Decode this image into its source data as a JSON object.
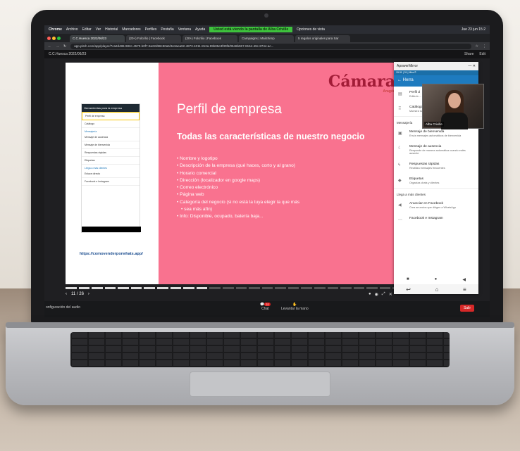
{
  "mac_menubar": {
    "items": [
      "Chrome",
      "Archivo",
      "Editar",
      "Ver",
      "Historial",
      "Marcadores",
      "Perfiles",
      "Pestaña",
      "Ventana",
      "Ayuda"
    ],
    "sub": "Grabando",
    "sharing_banner": "Usted está viendo la pantalla de Alba Criville",
    "view_options": "Opciones de vista",
    "clock": "Jue 23 jun 15:2"
  },
  "browser": {
    "tabs": [
      "C.C.Huesca 2022/06/23",
      "(20+) Folcrilio | Facebook",
      "(20+) Folcrilio | Facebook",
      "Campaigns | Mailchimp",
      "5 regalos originales para Sar"
    ],
    "url": "app.pitch.com/app/player/7ca2d486-982c-4570-b0f7-8a22d98c90a5/3e3aea92-4873-4011-812a-99b85e3f30f6/0546b067-8154-49c-8744-ac..."
  },
  "pitch": {
    "doc_title": "C.C.Huesca 2022/06/23",
    "share_label": "Share",
    "edit_label": "Edit",
    "page_indicator": "11 / 26"
  },
  "slide": {
    "logo": "Cámara",
    "logo_sub": "Aragón",
    "title": "Perfil de empresa",
    "subtitle": "Todas las características de nuestro negocio",
    "bullets": [
      "Nombre y logotipo",
      "Descripción de la empresa (qué haces, corto y al grano)",
      "Horario comercial",
      "Dirección (localizador en google maps)",
      "Correo electrónico",
      "Página web",
      "Categoría del negocio (si no está la tuya elegir la que más",
      "sea más afín)",
      "Info: Disponible, ocupado, batería baja..."
    ],
    "link": "https://comovenderporwhats.app/",
    "phone_header": "Herramientas para la empresa",
    "phone_items": [
      "Perfil de empresa",
      "Catálogo",
      "Mensaje de ausencia",
      "Mensaje de bienvenida",
      "Respuestas rápidas",
      "Etiquetas"
    ],
    "phone_section1": "Mensajería",
    "phone_section2": "Llega a más clientes",
    "phone_items2": [
      "Enlace directo",
      "Facebook e Instagram"
    ]
  },
  "mirror": {
    "title": "ApowerMirror",
    "status": "15:31 | 31 | Mira ©",
    "header": "Herra",
    "person_name": "Alba Criville",
    "items": [
      {
        "label": "Perfil d",
        "desc": "Edita la ... web"
      },
      {
        "label": "Catálogo",
        "desc": "Muestra tus productos y servicios"
      }
    ],
    "section1": "Mensajería",
    "items2": [
      {
        "label": "Mensaje de bienvenida",
        "desc": "Envía mensajes automáticos de bienvenida"
      },
      {
        "label": "Mensaje de ausencia",
        "desc": "Responde de manera automática cuando estés ausente"
      },
      {
        "label": "Respuestas rápidas",
        "desc": "Reutiliza mensajes frecuentes"
      },
      {
        "label": "Etiquetas",
        "desc": "Organiza chats y clientes"
      }
    ],
    "section2": "Llega a más clientes",
    "items3": [
      {
        "label": "Anunciar en Facebook",
        "desc": "Crea anuncios que dirigen a WhatsApp"
      },
      {
        "label": "Facebook e Instagram",
        "desc": ""
      }
    ]
  },
  "zoom": {
    "audio_config": "onfiguración del audio",
    "chat_label": "Chat",
    "chat_badge": "22",
    "raise_hand_label": "Levantar la mano",
    "leave_label": "Salir"
  },
  "colors": {
    "slide_pink": "#f9728f",
    "logo_red": "#a21c37",
    "sharing_green": "#3ec23d",
    "leave_red": "#d62828"
  }
}
